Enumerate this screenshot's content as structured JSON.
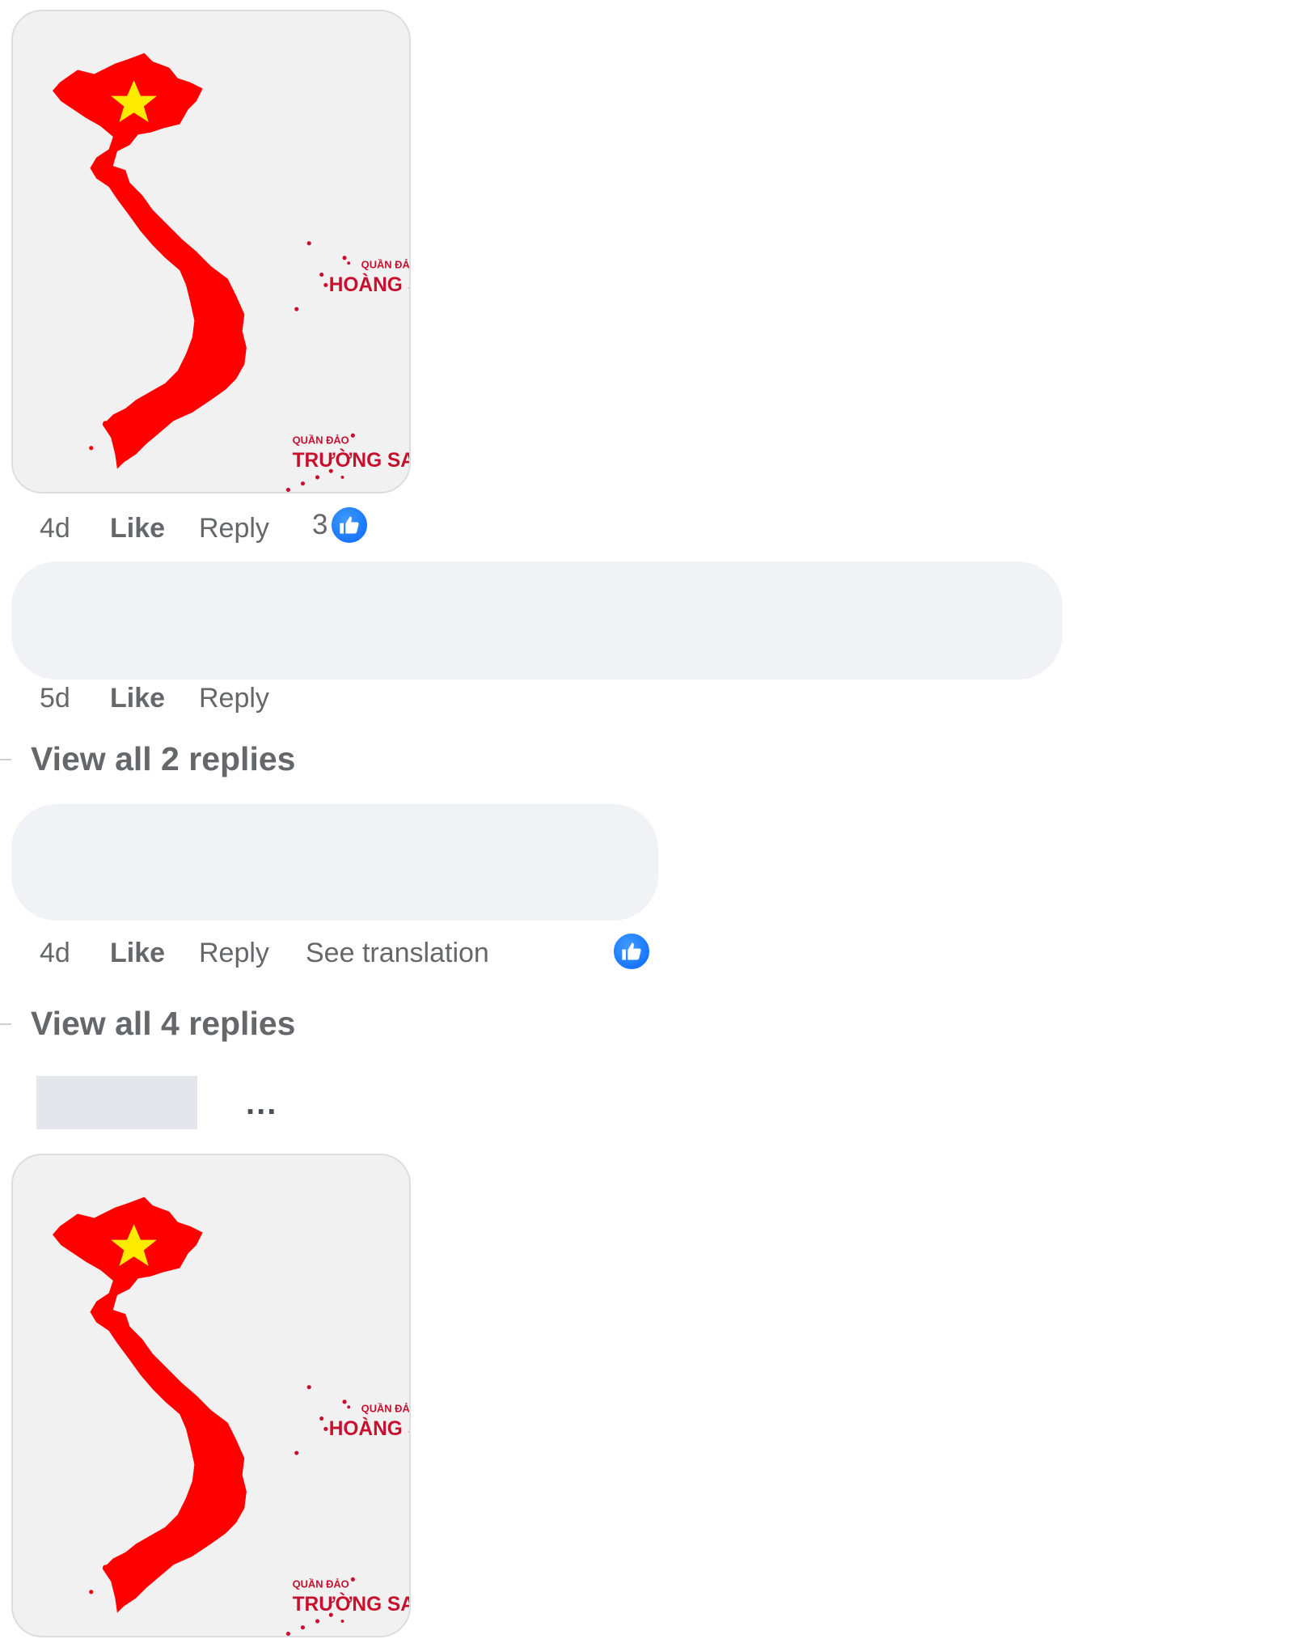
{
  "comments": [
    {
      "time": "4d",
      "like_label": "Like",
      "reply_label": "Reply",
      "reaction_count": "3",
      "image": {
        "label_hoang_sa_small": "QUẦN ĐẢO",
        "label_hoang_sa": "HOÀNG SA",
        "label_truong_sa_small": "QUẦN ĐẢO",
        "label_truong_sa": "TRƯỜNG SA"
      }
    },
    {
      "time": "5d",
      "like_label": "Like",
      "reply_label": "Reply"
    },
    {
      "time": "4d",
      "like_label": "Like",
      "reply_label": "Reply",
      "translation_label": "See translation"
    }
  ],
  "view_replies": [
    {
      "label": "View all 2 replies"
    },
    {
      "label": "View all 4 replies"
    }
  ],
  "next_comment": {
    "more_label": "...",
    "image": {
      "label_hoang_sa_small": "QUẦN ĐẢO",
      "label_hoang_sa": "HOÀNG SA",
      "label_truong_sa_small": "QUẦN ĐẢO",
      "label_truong_sa": "TRƯỜNG SA"
    }
  },
  "colors": {
    "map_red": "#ff0000",
    "star_yellow": "#ffeb00",
    "like_blue": "#0866ff",
    "bubble_bg": "#f0f2f5",
    "meta_text": "#65676b"
  },
  "icons": {
    "reaction": "thumbs-up-icon",
    "more": "more-options-icon"
  }
}
